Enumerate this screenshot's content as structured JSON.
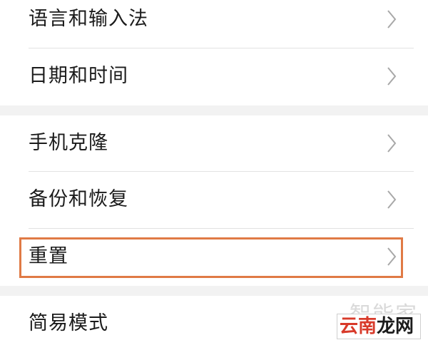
{
  "settings": {
    "items": [
      {
        "label": "语言和输入法",
        "chevron": "chevron-right-icon"
      },
      {
        "label": "日期和时间",
        "chevron": "chevron-right-icon"
      },
      {
        "label": "手机克隆",
        "chevron": "chevron-right-icon"
      },
      {
        "label": "备份和恢复",
        "chevron": "chevron-right-icon"
      },
      {
        "label": "重置",
        "chevron": "chevron-right-icon",
        "highlighted": true
      },
      {
        "label": "简易模式",
        "chevron": "chevron-right-icon"
      }
    ]
  },
  "watermark": {
    "top": "智能家",
    "brand_part1": "云南",
    "brand_part2": "龙网"
  },
  "colors": {
    "highlight_border": "#e07a45",
    "group_gap": "#f2f2f2",
    "divider": "#e2e2e2",
    "chevron": "#a8a8a8",
    "watermark_red": "#d83a2a"
  }
}
